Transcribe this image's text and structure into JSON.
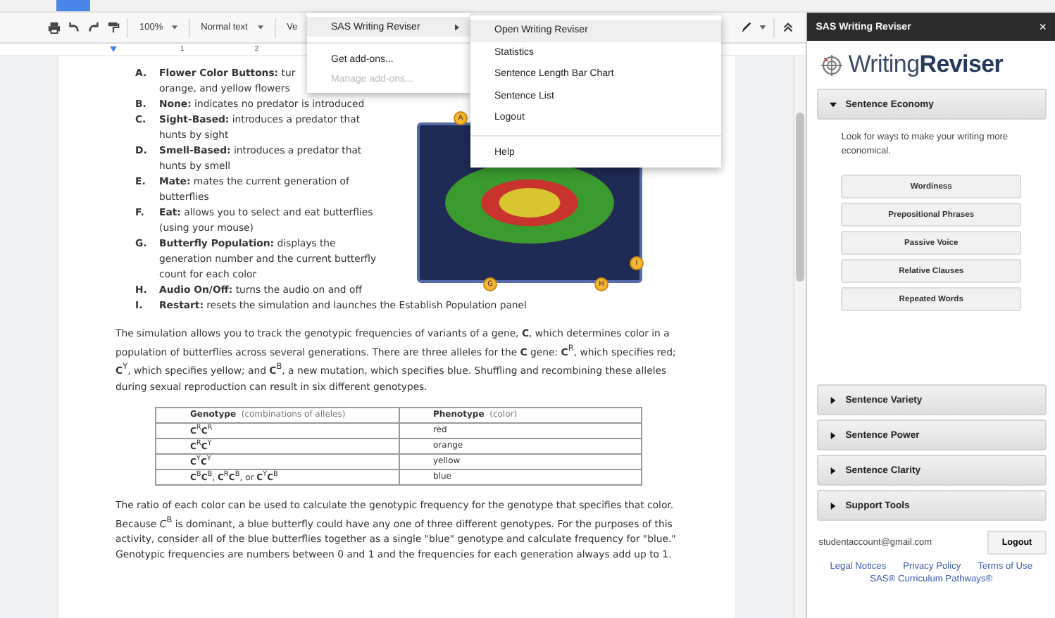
{
  "toolbar": {
    "zoom": "100%",
    "style": "Normal text",
    "font": "Ve"
  },
  "ruler": {
    "marks": [
      "1",
      "2"
    ]
  },
  "addons_menu": {
    "items": [
      {
        "label": "SAS Writing Reviser",
        "kind": "submenu",
        "disabled": false,
        "selected": true
      },
      {
        "label": "Get add-ons...",
        "kind": "item",
        "disabled": false,
        "selected": false
      },
      {
        "label": "Manage add-ons...",
        "kind": "item",
        "disabled": true,
        "selected": false
      }
    ]
  },
  "submenu": {
    "items": [
      {
        "label": "Open Writing Reviser",
        "selected": true
      },
      {
        "label": "Statistics",
        "selected": false
      },
      {
        "label": "Sentence Length Bar Chart",
        "selected": false
      },
      {
        "label": "Sentence List",
        "selected": false
      },
      {
        "label": "Logout",
        "selected": false
      },
      {
        "label": "Help",
        "selected": false
      }
    ]
  },
  "document": {
    "list": [
      {
        "marker": "A.",
        "lines": [
          "**Flower Color Buttons:** tur",
          "orange, and yellow flowers"
        ]
      },
      {
        "marker": "B.",
        "lines": [
          "**None:** indicates no predator is introduced"
        ]
      },
      {
        "marker": "C.",
        "lines": [
          "**Sight-Based:** introduces a predator that",
          "hunts by sight"
        ]
      },
      {
        "marker": "D.",
        "lines": [
          "**Smell-Based:** introduces a predator that",
          "hunts by smell"
        ]
      },
      {
        "marker": "E.",
        "lines": [
          "**Mate:** mates the current generation of",
          "butterflies"
        ]
      },
      {
        "marker": "F.",
        "lines": [
          "**Eat:** allows you to select and eat butterflies",
          "(using your mouse)"
        ]
      },
      {
        "marker": "G.",
        "lines": [
          "**Butterfly Population:** displays the",
          "generation number and the current butterfly",
          "count for each color"
        ]
      },
      {
        "marker": "H.",
        "lines": [
          "**Audio On/Off:** turns the audio on and off"
        ]
      },
      {
        "marker": "I.",
        "lines": [
          "**Restart:** resets the simulation and launches the Establish Population panel"
        ]
      }
    ],
    "figure_callouts": [
      "A",
      "G",
      "H",
      "I"
    ],
    "paragraph_1": "The simulation allows you to track the genotypic frequencies of variants of a gene, **C**, which determines color in a population of butterflies across several generations. There are three alleles for the **C** gene: **C**$^{R}$, which specifies red; **C**$^{Y}$, which specifies yellow; and **C**$^{B}$, a new mutation, which specifies blue. Shuffling and recombining these alleles during sexual reproduction can result in six different genotypes.",
    "table": {
      "columns": [
        {
          "title": "Genotype",
          "note": "(combinations of alleles)"
        },
        {
          "title": "Phenotype",
          "note": "(color)"
        }
      ],
      "rows": [
        [
          "**C**$^{R}$**C**$^{R}$",
          "red"
        ],
        [
          "**C**$^{R}$**C**$^{Y}$",
          "orange"
        ],
        [
          "**C**$^{Y}$**C**$^{Y}$",
          "yellow"
        ],
        [
          "**C**$^{B}$**C**$^{B}$, **C**$^{R}$**C**$^{B}$, or **C**$^{Y}$**C**$^{B}$",
          "blue"
        ]
      ]
    },
    "paragraph_2": "The ratio of each color can be used to calculate the genotypic frequency for the genotype that specifies that color. Because *C*$^{B}$ is dominant, a blue butterfly could have any one of three different genotypes. For the purposes of this activity, consider all of the blue butterflies together as a single \"blue\" genotype and calculate frequency for \"blue.\" Genotypic frequencies are numbers between 0 and 1 and the frequencies for each generation always add up to 1."
  },
  "sidebar": {
    "title": "SAS Writing Reviser",
    "close": "×",
    "logo_light": "Writing",
    "logo_bold": "Reviser",
    "sections": [
      {
        "title": "Sentence Economy",
        "expanded": true,
        "description": "Look for ways to make your writing more economical.",
        "buttons": [
          "Wordiness",
          "Prepositional Phrases",
          "Passive Voice",
          "Relative Clauses",
          "Repeated Words"
        ]
      },
      {
        "title": "Sentence Variety",
        "expanded": false
      },
      {
        "title": "Sentence Power",
        "expanded": false
      },
      {
        "title": "Sentence Clarity",
        "expanded": false
      },
      {
        "title": "Support Tools",
        "expanded": false
      }
    ],
    "email": "studentaccount@gmail.com",
    "logout": "Logout",
    "links": [
      "Legal Notices",
      "Privacy Policy",
      "Terms of Use"
    ],
    "footer_link": "SAS® Curriculum Pathways®"
  }
}
